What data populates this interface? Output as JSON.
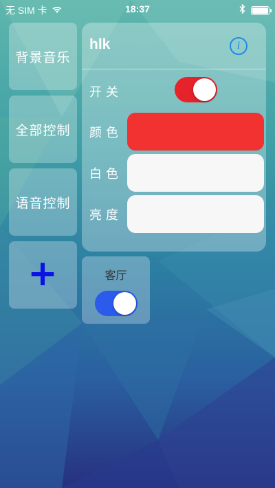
{
  "status_bar": {
    "carrier": "无 SIM 卡",
    "time": "18:37",
    "wifi_icon": "wifi-icon",
    "bluetooth_icon": "bluetooth-icon",
    "battery_icon": "battery-icon"
  },
  "sidebar": {
    "items": [
      {
        "label": "背景音乐"
      },
      {
        "label": "全部控制"
      },
      {
        "label": "语音控制"
      },
      {
        "label": "+"
      }
    ]
  },
  "device_panel": {
    "title": "hlk",
    "info_icon": "info-icon",
    "info_glyph": "i",
    "switch_label": "开关",
    "switch_on": true,
    "color_label": "颜色",
    "color_value": "#f23131",
    "white_label": "白色",
    "white_value": "#f7f7f7",
    "brightness_label": "亮度",
    "brightness_value": "#f7f7f7"
  },
  "room": {
    "label": "客厅",
    "switch_on": true
  },
  "colors": {
    "accent_blue": "#2a5bea",
    "switch_red": "#e6222a",
    "info_blue": "#1a8be8",
    "plus_blue": "#0a12e6"
  }
}
